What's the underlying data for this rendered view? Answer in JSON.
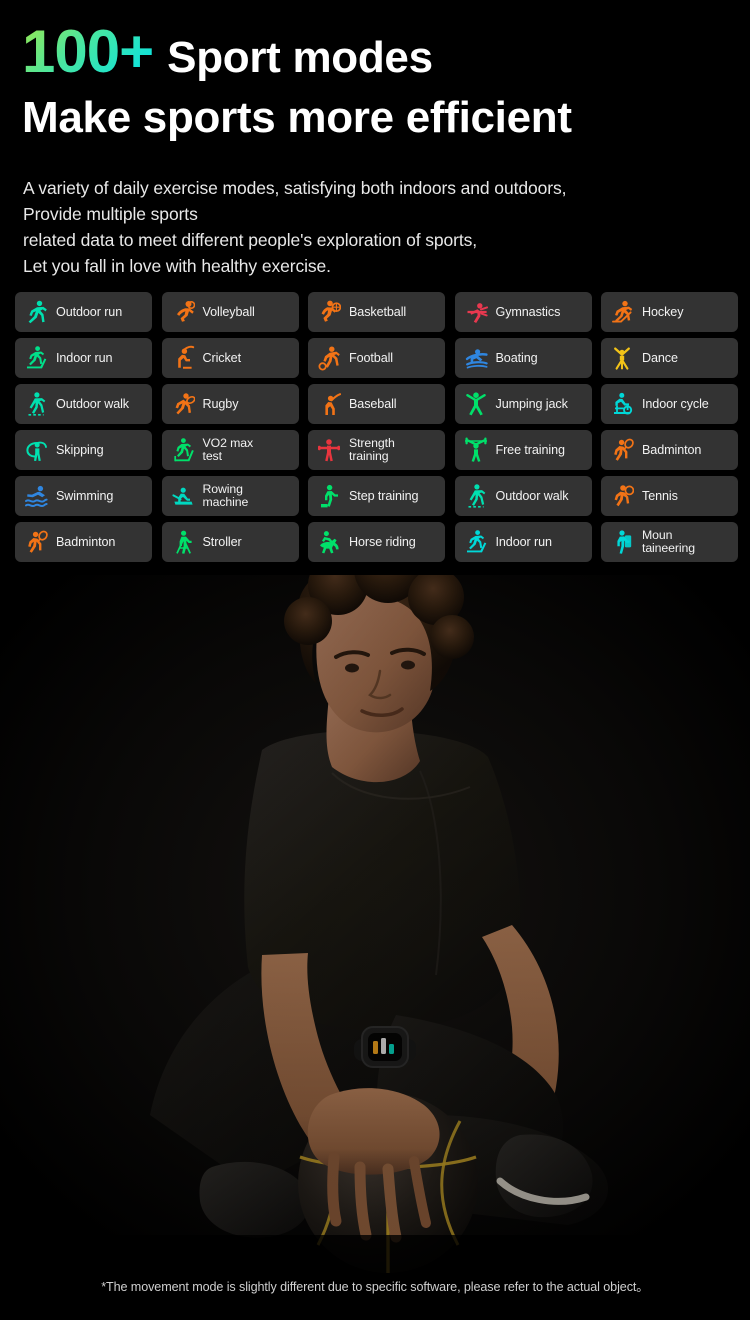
{
  "headline": {
    "number": "100+",
    "main": "Sport modes",
    "line2": "Make sports more efficient",
    "gradient_start": "#9ae84f",
    "gradient_end": "#00e2ea"
  },
  "subcopy": {
    "line1": "A variety of daily exercise modes, satisfying both indoors and outdoors,",
    "line2": "Provide multiple sports",
    "line3": "related data to meet different people's exploration of sports,",
    "line4": "Let you fall in love with healthy exercise."
  },
  "card_style": {
    "background": "#333333",
    "label_color": "#f2f2f2"
  },
  "sports": [
    {
      "label": "Outdoor run",
      "icon": "running-icon",
      "color": "#00e0b0"
    },
    {
      "label": "Volleyball",
      "icon": "volleyball-icon",
      "color": "#f27316"
    },
    {
      "label": "Basketball",
      "icon": "basketball-icon",
      "color": "#f27316"
    },
    {
      "label": "Gymnastics",
      "icon": "gymnastics-icon",
      "color": "#e8384f"
    },
    {
      "label": "Hockey",
      "icon": "hockey-icon",
      "color": "#f27316"
    },
    {
      "label": "Indoor run",
      "icon": "treadmill-icon",
      "color": "#00e08a"
    },
    {
      "label": "Cricket",
      "icon": "cricket-icon",
      "color": "#f27316"
    },
    {
      "label": "Football",
      "icon": "football-icon",
      "color": "#f27316"
    },
    {
      "label": "Boating",
      "icon": "kayak-icon",
      "color": "#2f86e0"
    },
    {
      "label": "Dance",
      "icon": "dance-icon",
      "color": "#f2c318"
    },
    {
      "label": "Outdoor walk",
      "icon": "walking-icon",
      "color": "#00e0b0"
    },
    {
      "label": "Rugby",
      "icon": "rugby-icon",
      "color": "#f27316"
    },
    {
      "label": "Baseball",
      "icon": "baseball-icon",
      "color": "#f27316"
    },
    {
      "label": "Jumping jack",
      "icon": "jumping-jack-icon",
      "color": "#00e06a"
    },
    {
      "label": "Indoor cycle",
      "icon": "spin-bike-icon",
      "color": "#00d8d8"
    },
    {
      "label": "Skipping",
      "icon": "jump-rope-icon",
      "color": "#00e0b0"
    },
    {
      "label": "VO2 max\ntest",
      "icon": "vo2-treadmill-icon",
      "color": "#00e06a"
    },
    {
      "label": "Strength\ntraining",
      "icon": "strength-icon",
      "color": "#e8353e"
    },
    {
      "label": "Free training",
      "icon": "barbell-icon",
      "color": "#00e06a"
    },
    {
      "label": "Badminton",
      "icon": "badminton-icon",
      "color": "#f27316"
    },
    {
      "label": "Swimming",
      "icon": "swimming-icon",
      "color": "#2f86e0"
    },
    {
      "label": "Rowing\nmachine",
      "icon": "rowing-machine-icon",
      "color": "#00d8c0"
    },
    {
      "label": "Step training",
      "icon": "step-icon",
      "color": "#00e06a"
    },
    {
      "label": "Outdoor walk",
      "icon": "walking-icon",
      "color": "#00e0b0"
    },
    {
      "label": "Tennis",
      "icon": "tennis-icon",
      "color": "#f27316"
    },
    {
      "label": "Badminton",
      "icon": "badminton-icon",
      "color": "#f27316"
    },
    {
      "label": "Stroller",
      "icon": "hiking-pole-icon",
      "color": "#00e06a"
    },
    {
      "label": "Horse riding",
      "icon": "equestrian-icon",
      "color": "#00e06a"
    },
    {
      "label": "Indoor run",
      "icon": "treadmill-icon",
      "color": "#00d8d8"
    },
    {
      "label": "Moun\ntaineering",
      "icon": "mountaineering-icon",
      "color": "#00d8d8"
    }
  ],
  "dots": {
    "count": 6,
    "color": "#ffffff"
  },
  "photo": {
    "alt": "Young man in black athletic wear crouching with hand on a basketball, wearing a smartwatch"
  },
  "footer": {
    "disclaimer": "*The movement mode is slightly different due to specific software, please refer to the actual object。"
  }
}
